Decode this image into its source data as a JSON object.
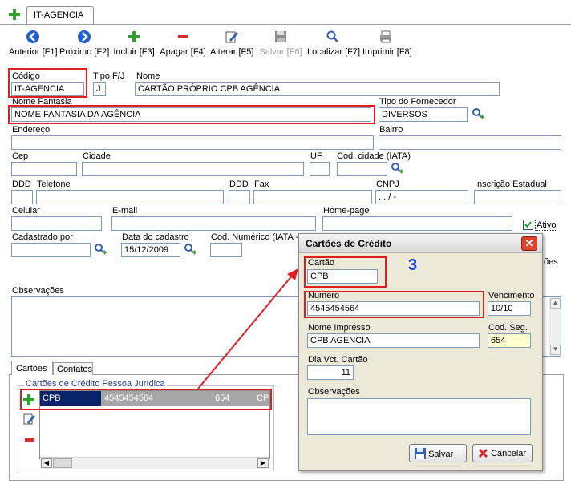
{
  "window_tab": {
    "title": "IT-AGENCIA"
  },
  "toolbar": {
    "anterior": "Anterior [F1]",
    "proximo": "Próximo [F2]",
    "incluir": "Incluir [F3]",
    "apagar": "Apagar [F4]",
    "alterar": "Alterar [F5]",
    "salvar": "Salvar [F6]",
    "localizar": "Localizar [F7]",
    "imprimir": "Imprimir [F8]"
  },
  "form": {
    "codigo_label": "Código",
    "codigo_value": "IT-AGENCIA",
    "tipo_label": "Tipo F/J",
    "tipo_value": "J",
    "nome_label": "Nome",
    "nome_value": "CARTÃO PRÓPRIO CPB AGÊNCIA",
    "fantasia_label": "Nome Fantasia",
    "fantasia_value": "NOME FANTASIA DA AGÊNCIA",
    "tipo_fornecedor_label": "Tipo do Fornecedor",
    "tipo_fornecedor_value": "DIVERSOS",
    "endereco_label": "Endereço",
    "endereco_value": "",
    "bairro_label": "Bairro",
    "bairro_value": "",
    "cep_label": "Cep",
    "cidade_label": "Cidade",
    "uf_label": "UF",
    "cod_cidade_label": "Cod. cidade (IATA)",
    "ddd1_label": "DDD",
    "telefone_label": "Telefone",
    "ddd2_label": "DDD",
    "fax_label": "Fax",
    "cnpj_label": "CNPJ",
    "cnpj_value": " .   .   /   -",
    "inscricao_label": "Inscrição Estadual",
    "celular_label": "Celular",
    "email_label": "E-mail",
    "homepage_label": "Home-page",
    "ativo_label": "Ativo",
    "ativo_checked": true,
    "cadastrado_label": "Cadastrado por",
    "data_cadastro_label": "Data do cadastro",
    "data_cadastro_value": "15/12/2009",
    "cod_numerico_label": "Cod. Numérico (IATA -",
    "observacoes_label": "Observações",
    "partial_right_label": "ões"
  },
  "bottom_panel": {
    "tabs": [
      "Cartões",
      "Contatos"
    ],
    "group_label": "Cartões de Crédito Pessoa Jurídica",
    "row": {
      "cartao": "CPB",
      "numero": "4545454564",
      "cod": "654",
      "trunc": "CP"
    }
  },
  "dialog": {
    "title": "Cartões de Crédito",
    "close": "✕",
    "cartao_label": "Cartão",
    "cartao_value": "CPB",
    "annotation": "3",
    "numero_label": "Numero",
    "numero_value": "4545454564",
    "vencimento_label": "Vencimento",
    "vencimento_value": "10/10",
    "nome_impresso_label": "Nome Impresso",
    "nome_impresso_value": "CPB AGENCIA",
    "cod_seg_label": "Cod. Seg.",
    "cod_seg_value": "654",
    "dia_vct_label": "Dia Vct. Cartão",
    "dia_vct_value": "11",
    "observacoes_label": "Observações",
    "salvar": "Salvar",
    "cancelar": "Cancelar"
  },
  "colors": {
    "highlight": "#e02020",
    "annotation": "#1f3fd6",
    "selected_row": "#0a246a"
  }
}
